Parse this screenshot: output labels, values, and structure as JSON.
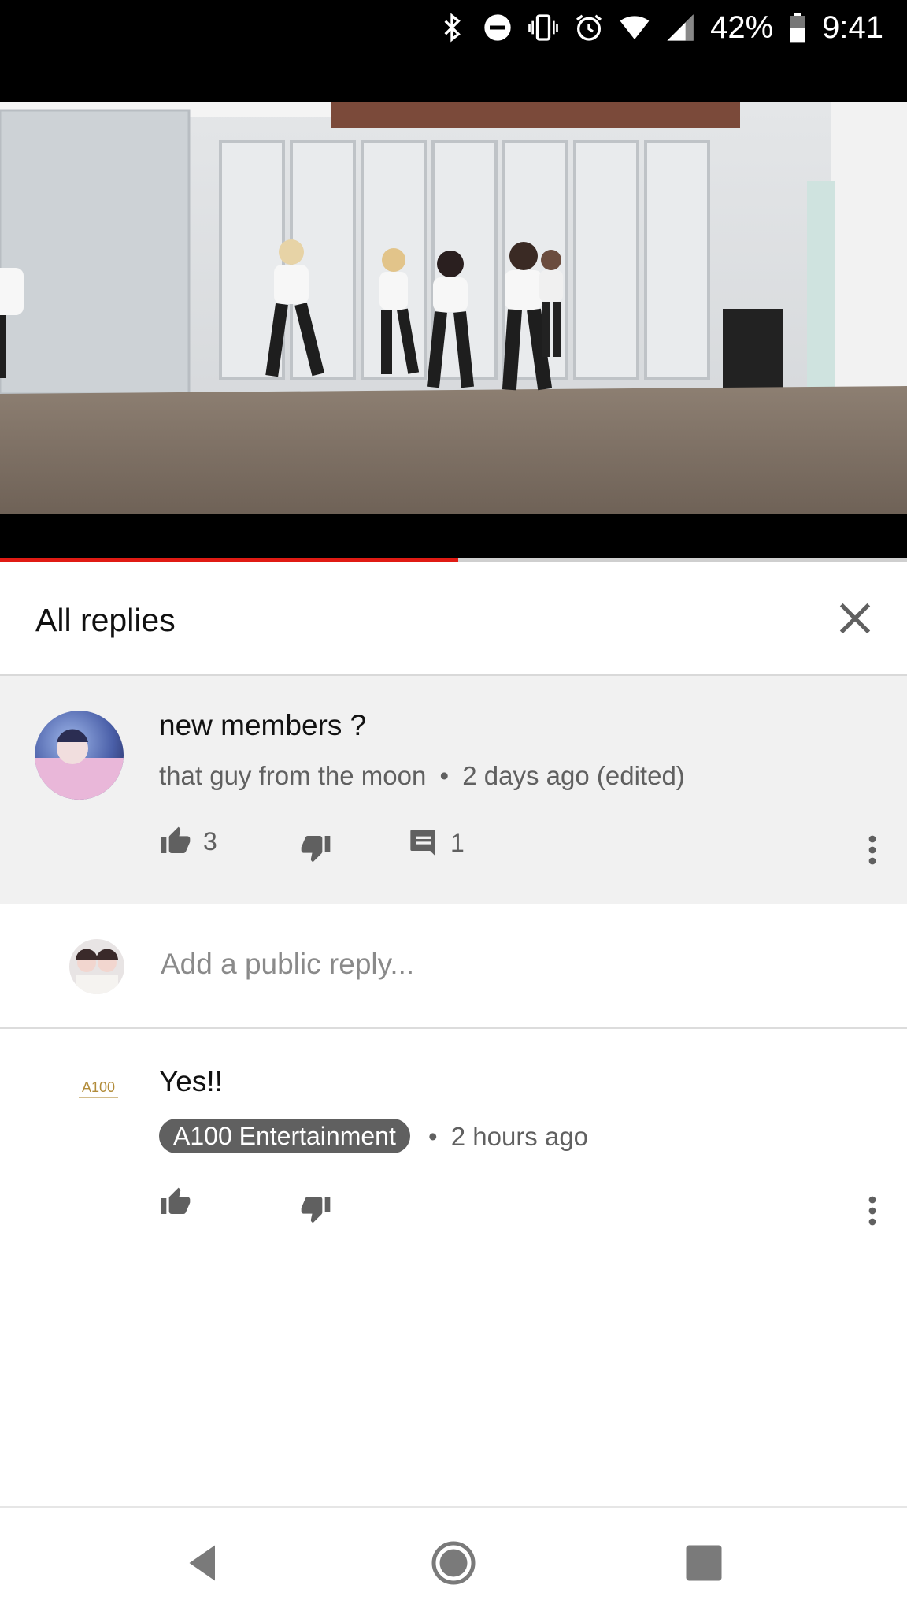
{
  "status_bar": {
    "battery": "42%",
    "time": "9:41",
    "icons": [
      "bluetooth-icon",
      "do-not-disturb-icon",
      "vibrate-icon",
      "alarm-icon",
      "wifi-icon",
      "cell-signal-icon",
      "battery-icon"
    ]
  },
  "video": {
    "progress": 0.505,
    "progress_color": "#e01b14"
  },
  "header": {
    "title": "All replies"
  },
  "original_comment": {
    "text": "new members ?",
    "author": "that guy from the moon",
    "separator": "•",
    "time": "2 days ago (edited)",
    "likes": "3",
    "replies": "1"
  },
  "reply_input": {
    "placeholder": "Add a public reply..."
  },
  "reply_comment": {
    "text": "Yes!!",
    "author": "A100 Entertainment",
    "separator": "•",
    "time": "2 hours ago",
    "logo": "A100"
  },
  "nav": {
    "buttons": [
      "back-icon",
      "home-icon",
      "recents-icon"
    ]
  }
}
